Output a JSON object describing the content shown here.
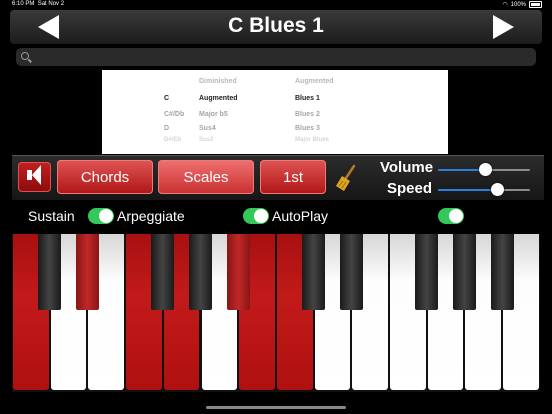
{
  "status_bar": {
    "time": "6:10 PM",
    "date": "Sat Nov 2",
    "battery": "100%"
  },
  "header": {
    "title": "C Blues 1"
  },
  "search": {
    "placeholder": "",
    "value": ""
  },
  "picker": {
    "rows": [
      {
        "c0": "",
        "c1": "Diminished",
        "c2": "Augmented"
      },
      {
        "c0": "C",
        "c1": "Augmented",
        "c2": "Blues 1"
      },
      {
        "c0": "C#/Db",
        "c1": "Major b5",
        "c2": "Blues 2"
      },
      {
        "c0": "D",
        "c1": "Sus4",
        "c2": "Blues 3"
      },
      {
        "c0": "D#/Eb",
        "c1": "Sus2",
        "c2": "Major Blues"
      }
    ]
  },
  "controls": {
    "chords_label": "Chords",
    "scales_label": "Scales",
    "inversion_label": "1st",
    "volume_label": "Volume",
    "speed_label": "Speed",
    "volume_level": 0.51,
    "speed_level": 0.64
  },
  "options": {
    "sustain_label": "Sustain",
    "arpeggiate_label": "Arpeggiate",
    "autoplay_label": "AutoPlay",
    "sustain_on": true,
    "arpeggiate_on": true,
    "autoplay_on": true
  },
  "keyboard": {
    "white_pressed": [
      true,
      false,
      false,
      true,
      true,
      false,
      true,
      true,
      false,
      false,
      false,
      false,
      false,
      false
    ],
    "black_pressed": [
      false,
      true,
      false,
      false,
      true,
      false,
      false,
      false,
      false,
      false
    ]
  },
  "colors": {
    "accent_red": "#b01515",
    "toggle_green": "#34c759",
    "slider_blue": "#2a7ee0"
  }
}
